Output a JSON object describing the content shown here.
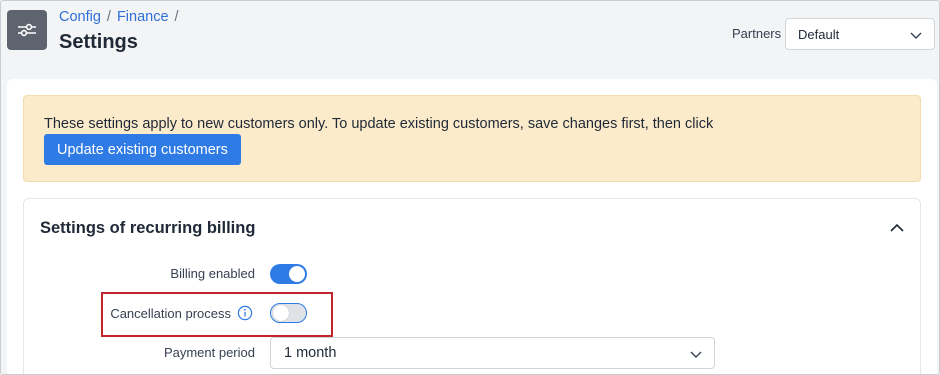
{
  "header": {
    "breadcrumb": [
      "Config",
      "Finance"
    ],
    "separator": "/",
    "title": "Settings",
    "app_icon": "sliders-icon"
  },
  "partners": {
    "label": "Partners",
    "selected": "Default"
  },
  "notice": {
    "text": "These settings apply to new customers only. To update existing customers, save changes first, then click",
    "button_label": "Update existing customers"
  },
  "section": {
    "title": "Settings of recurring billing",
    "collapse_icon": "chevron-up-icon",
    "fields": {
      "billing_enabled": {
        "label": "Billing enabled",
        "value": true
      },
      "cancellation_process": {
        "label": "Cancellation process",
        "value": false,
        "info_icon": "info-icon"
      },
      "payment_period": {
        "label": "Payment period",
        "value": "1 month"
      }
    }
  },
  "colors": {
    "accent": "#2f7be5",
    "link": "#2f6fd8",
    "notice_bg": "#fcebca",
    "highlight": "#c0262b"
  }
}
